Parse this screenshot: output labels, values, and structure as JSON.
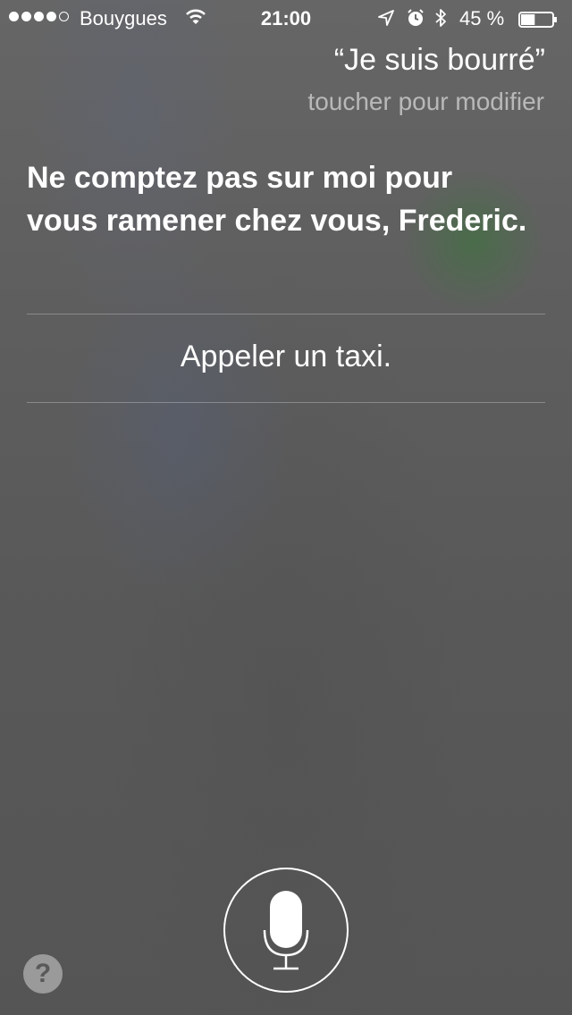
{
  "status_bar": {
    "carrier": "Bouygues",
    "time": "21:00",
    "battery_percent": "45 %",
    "battery_level": 0.45,
    "signal_bars_filled": 4,
    "signal_bars_total": 5,
    "icons": [
      "wifi-icon",
      "location-icon",
      "alarm-icon",
      "bluetooth-icon",
      "battery-icon"
    ]
  },
  "query": {
    "text": "“Je suis bourré”",
    "edit_hint": "toucher pour modifier"
  },
  "response": {
    "text": "Ne comptez pas sur moi pour vous ramener chez vous, Frederic."
  },
  "suggestion": {
    "label": "Appeler un taxi."
  },
  "controls": {
    "mic_icon": "microphone-icon",
    "help_label": "?"
  },
  "colors": {
    "background": "#5a5a5a",
    "text": "#ffffff",
    "accent_glow": "#4f7a4f"
  }
}
